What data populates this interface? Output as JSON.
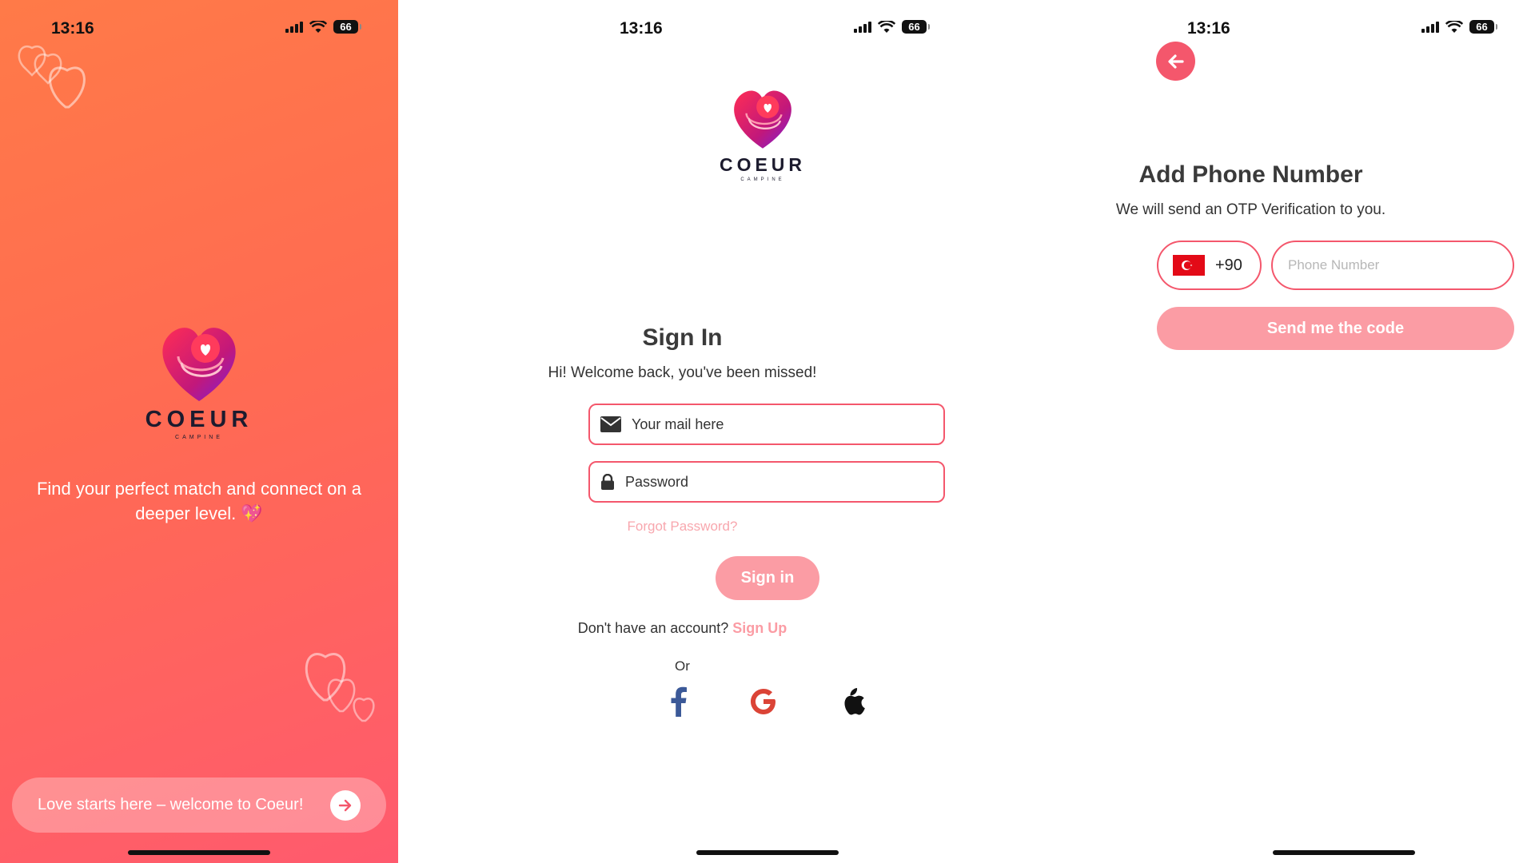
{
  "status": {
    "time": "13:16",
    "battery": "66"
  },
  "welcome": {
    "brand": "COEUR",
    "brand_sub": "CAMPINE",
    "tagline": "Find your perfect match and connect on a deeper level. 💖",
    "cta_label": "Love starts here – welcome to Coeur!"
  },
  "signin": {
    "brand": "COEUR",
    "brand_sub": "CAMPINE",
    "title": "Sign In",
    "subtitle": "Hi! Welcome back, you've been missed!",
    "email_placeholder": "Your mail here",
    "password_placeholder": "Password",
    "forgot_label": "Forgot Password?",
    "button_label": "Sign in",
    "no_account_text": "Don't have an account?",
    "signup_link": "Sign Up",
    "or_label": "Or",
    "social": [
      "facebook-icon",
      "google-icon",
      "apple-icon"
    ]
  },
  "phone": {
    "title": "Add Phone Number",
    "subtitle": "We will send an OTP Verification to you.",
    "country_code": "+90",
    "country_flag": "turkey-flag-icon",
    "phone_placeholder": "Phone Number",
    "send_label": "Send me the code"
  },
  "colors": {
    "accent": "#f4576c",
    "button_disabled": "#fb9ca4",
    "gradient_top": "#ff7a48",
    "gradient_bottom": "#ff5a6e"
  }
}
